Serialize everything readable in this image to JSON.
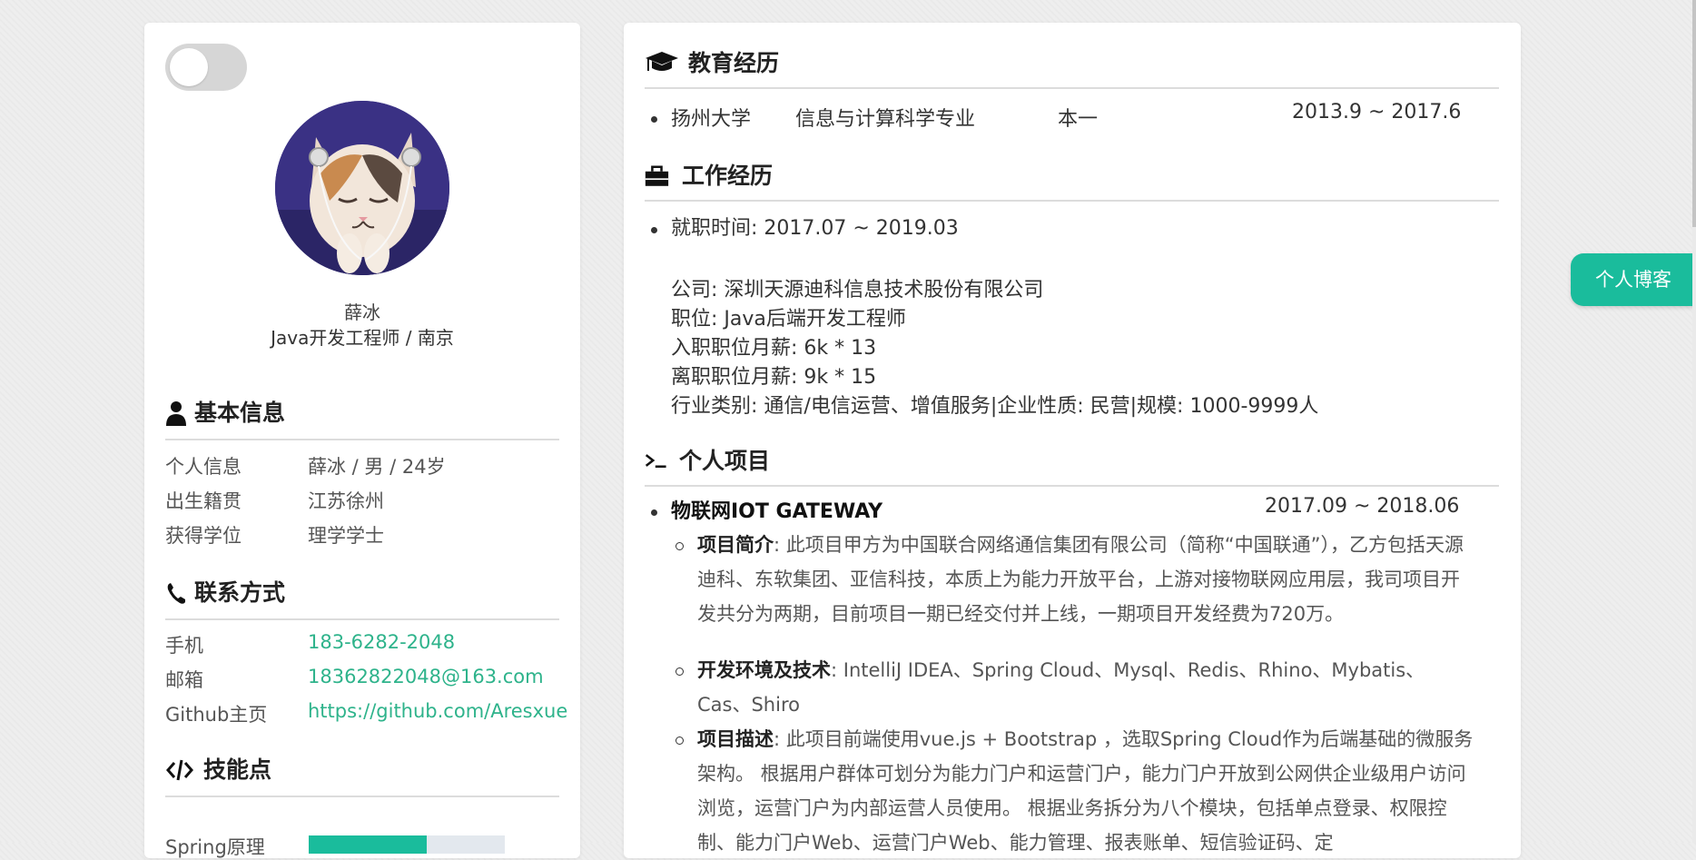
{
  "profile": {
    "name": "薛冰",
    "title": "Java开发工程师 / 南京"
  },
  "basic_info": {
    "heading": "基本信息",
    "rows": [
      {
        "label": "个人信息",
        "value": "薛冰 / 男 / 24岁"
      },
      {
        "label": "出生籍贯",
        "value": "江苏徐州"
      },
      {
        "label": "获得学位",
        "value": "理学学士"
      }
    ]
  },
  "contact": {
    "heading": "联系方式",
    "rows": [
      {
        "label": "手机",
        "value": "183-6282-2048"
      },
      {
        "label": "邮箱",
        "value": "18362822048@163.com"
      },
      {
        "label": "Github主页",
        "value": "https://github.com/Aresxue"
      }
    ]
  },
  "skills": {
    "heading": "技能点",
    "items": [
      {
        "label": "Spring原理",
        "level": 0.6
      }
    ]
  },
  "education": {
    "heading": "教育经历",
    "school": "扬州大学",
    "major": "信息与计算科学专业",
    "degree": "本一",
    "period": "2013.9 ~ 2017.6"
  },
  "work": {
    "heading": "工作经历",
    "period": "就职时间: 2017.07 ~ 2019.03",
    "company": "公司: 深圳天源迪科信息技术股份有限公司",
    "position": "职位: Java后端开发工程师",
    "salary_in": "入职职位月薪: 6k * 13",
    "salary_out": "离职职位月薪: 9k * 15",
    "industry": "行业类别: 通信/电信运营、增值服务|企业性质: 民营|规模: 1000-9999人"
  },
  "projects": {
    "heading": "个人项目",
    "items": [
      {
        "name": "物联网IOT GATEWAY",
        "period": "2017.09 ~ 2018.06",
        "intro_label": "项目简介",
        "intro": ": 此项目甲方为中国联合网络通信集团有限公司（简称“中国联通”），乙方包括天源迪科、东软集团、亚信科技，本质上为能力开放平台，上游对接物联网应用层，我司项目开发共分为两期，目前项目一期已经交付并上线，一期项目开发经费为720万。",
        "env_label": "开发环境及技术",
        "env": ": IntelliJ IDEA、Spring Cloud、Mysql、Redis、Rhino、Mybatis、Cas、Shiro",
        "desc_label": "项目描述",
        "desc": ": 此项目前端使用vue.js + Bootstrap ，选取Spring Cloud作为后端基础的微服务架构。 根据用户群体可划分为能力门户和运营门户，能力门户开放到公网供企业级用户访问浏览，运营门户为内部运营人员使用。 根据业务拆分为八个模块，包括单点登录、权限控制、能力门户Web、运营门户Web、能力管理、报表账单、短信验证码、定"
      }
    ]
  },
  "blog_button": "个人博客",
  "colors": {
    "accent": "#1abc9c",
    "link": "#2eb38b"
  }
}
